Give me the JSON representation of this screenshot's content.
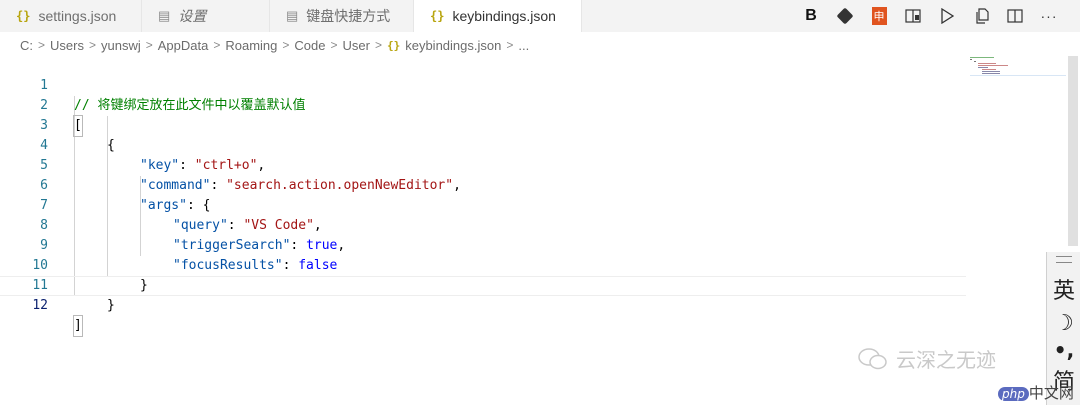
{
  "tabs": [
    {
      "label": "settings.json",
      "icon": "json-braces-icon",
      "active": false
    },
    {
      "label": "设置",
      "icon": "settings-file-icon",
      "active": false
    },
    {
      "label": "键盘快捷方式",
      "icon": "keyboard-file-icon",
      "active": false
    },
    {
      "label": "keybindings.json",
      "icon": "json-braces-icon",
      "active": true,
      "unsaved": true
    }
  ],
  "tab_icon_glyph": "{}",
  "actions": [
    {
      "name": "bold-icon",
      "glyph": "B"
    },
    {
      "name": "git-icon",
      "glyph": "◆"
    },
    {
      "name": "translate-icon",
      "glyph": "申"
    },
    {
      "name": "open-preview-icon",
      "glyph": "⧉"
    },
    {
      "name": "run-icon",
      "glyph": "▷"
    },
    {
      "name": "copy-file-icon",
      "glyph": "⎘"
    },
    {
      "name": "split-editor-icon",
      "glyph": "◫"
    },
    {
      "name": "more-actions-icon",
      "glyph": "···"
    }
  ],
  "breadcrumb": {
    "items": [
      "C:",
      "Users",
      "yunswj",
      "AppData",
      "Roaming",
      "Code",
      "User"
    ],
    "file": "keybindings.json",
    "tail": "...",
    "separator": ">"
  },
  "editor": {
    "line_numbers": [
      "1",
      "2",
      "3",
      "4",
      "5",
      "6",
      "7",
      "8",
      "9",
      "10",
      "11",
      "12"
    ],
    "comment": "// 将键绑定放在此文件中以覆盖默认值",
    "open_bracket": "[",
    "close_bracket": "]",
    "open_brace": "{",
    "close_brace": "}",
    "key_key": "\"key\"",
    "key_val": "\"ctrl+o\"",
    "command_key": "\"command\"",
    "command_val": "\"search.action.openNewEditor\"",
    "args_key": "\"args\"",
    "query_key": "\"query\"",
    "query_val": "\"VS Code\"",
    "trigger_key": "\"triggerSearch\"",
    "trigger_val": "true",
    "focus_key": "\"focusResults\"",
    "focus_val": "false"
  },
  "ime": {
    "mode": "英",
    "moon": "☽",
    "punct": "•,",
    "simplified": "简"
  },
  "watermark": {
    "brand": "云深之无迹",
    "site_badge": "php",
    "site_text": "中文网"
  },
  "colors": {
    "comment": "#008000",
    "key": "#0451a5",
    "string": "#a31515",
    "keyword": "#0000ff",
    "line_number": "#237893",
    "json_icon": "#b8a50f"
  }
}
